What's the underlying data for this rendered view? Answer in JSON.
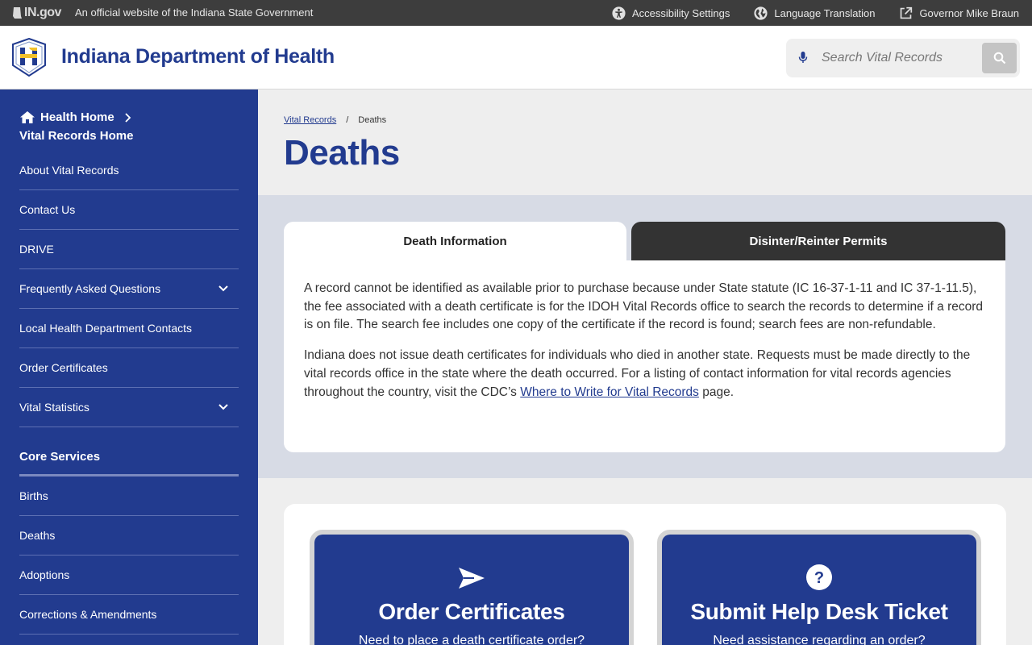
{
  "topbar": {
    "logo_text": "IN.gov",
    "official_text": "An official website of the Indiana State Government",
    "links": [
      {
        "label": "Accessibility Settings",
        "icon": "accessibility-icon"
      },
      {
        "label": "Language Translation",
        "icon": "globe-icon"
      },
      {
        "label": "Governor Mike Braun",
        "icon": "external-link-icon"
      }
    ]
  },
  "header": {
    "site_title": "Indiana Department of Health",
    "search_placeholder": "Search Vital Records"
  },
  "sidebar": {
    "home_label": "Health Home",
    "vr_home_label": "Vital Records Home",
    "items": [
      {
        "label": "About Vital Records",
        "expandable": false
      },
      {
        "label": "Contact Us",
        "expandable": false
      },
      {
        "label": "DRIVE",
        "expandable": false
      },
      {
        "label": "Frequently Asked Questions",
        "expandable": true
      },
      {
        "label": "Local Health Department Contacts",
        "expandable": false
      },
      {
        "label": "Order Certificates",
        "expandable": false
      },
      {
        "label": "Vital Statistics",
        "expandable": true
      }
    ],
    "core_title": "Core Services",
    "core_items": [
      {
        "label": "Births"
      },
      {
        "label": "Deaths"
      },
      {
        "label": "Adoptions"
      },
      {
        "label": "Corrections & Amendments"
      }
    ]
  },
  "main": {
    "breadcrumb": {
      "parent": "Vital Records",
      "sep": "/",
      "current": "Deaths"
    },
    "page_title": "Deaths",
    "tabs": [
      {
        "label": "Death Information",
        "active": true
      },
      {
        "label": "Disinter/Reinter Permits",
        "active": false
      }
    ],
    "panel": {
      "p1": "A record cannot be identified as available prior to purchase because under State statute (IC 16-37-1-11 and IC 37-1-11.5), the fee associated with a death certificate is for the IDOH Vital Records office to search the records to determine if a record is on file. The search fee includes one copy of the certificate if the record is found; search fees are non-refundable.",
      "p2_before": "Indiana does not issue death certificates for individuals who died in another state. Requests must be made directly to the vital records office in the state where the death occurred. For a listing of contact information for vital records agencies throughout the country, visit the CDC’s ",
      "p2_link": "Where to Write for Vital Records",
      "p2_after": " page."
    },
    "cards": [
      {
        "title": "Order Certificates",
        "subtitle": "Need to place a death certificate order?",
        "icon": "send-icon"
      },
      {
        "title": "Submit Help Desk Ticket",
        "subtitle": "Need assistance regarding an order?",
        "icon": "help-icon"
      }
    ]
  },
  "colors": {
    "brand_blue": "#223b8f",
    "topbar": "#3d3d3d",
    "inactive_tab": "#333333"
  }
}
